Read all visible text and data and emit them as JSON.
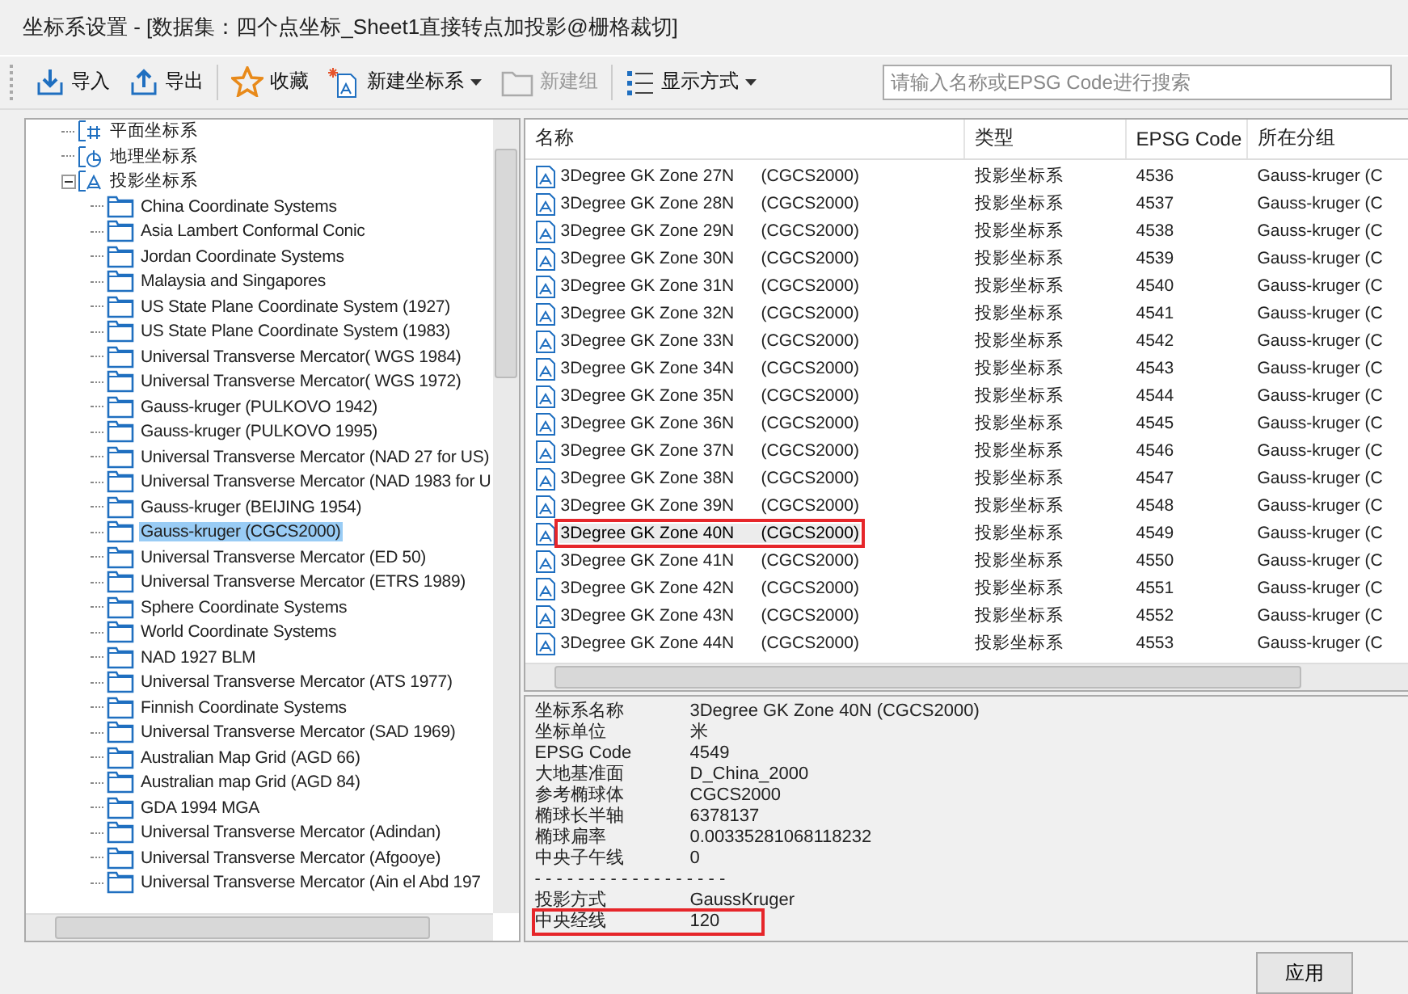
{
  "window": {
    "title": "坐标系设置 - [数据集：四个点坐标_Sheet1直接转点加投影@栅格裁切]"
  },
  "toolbar": {
    "items": [
      {
        "kind": "import",
        "label": "导入",
        "disabled": false,
        "dropdown": false
      },
      {
        "kind": "export",
        "label": "导出",
        "disabled": false,
        "dropdown": false
      },
      {
        "kind": "favorite",
        "label": "收藏",
        "disabled": false,
        "dropdown": false
      },
      {
        "kind": "new",
        "label": "新建坐标系",
        "disabled": false,
        "dropdown": true
      },
      {
        "kind": "group",
        "label": "新建组",
        "disabled": true,
        "dropdown": false
      },
      {
        "kind": "view",
        "label": "显示方式",
        "disabled": false,
        "dropdown": true
      }
    ],
    "search": {
      "placeholder": "请输入名称或EPSG Code进行搜索"
    }
  },
  "tree": [
    {
      "kind": "plane",
      "label": "平面坐标系",
      "selected": false
    },
    {
      "kind": "geo",
      "label": "地理坐标系",
      "selected": false
    },
    {
      "kind": "proj",
      "label": "投影坐标系",
      "selected": false,
      "expanded": true,
      "children": [
        {
          "label": "China Coordinate Systems",
          "selected": false
        },
        {
          "label": "Asia Lambert Conformal Conic",
          "selected": false
        },
        {
          "label": "Jordan Coordinate Systems",
          "selected": false
        },
        {
          "label": "Malaysia and Singapores",
          "selected": false
        },
        {
          "label": "US State Plane Coordinate System (1927)",
          "selected": false
        },
        {
          "label": "US State Plane Coordinate System (1983)",
          "selected": false
        },
        {
          "label": "Universal Transverse Mercator( WGS 1984)",
          "selected": false
        },
        {
          "label": "Universal Transverse Mercator( WGS 1972)",
          "selected": false
        },
        {
          "label": "Gauss-kruger (PULKOVO 1942)",
          "selected": false
        },
        {
          "label": "Gauss-kruger (PULKOVO 1995)",
          "selected": false
        },
        {
          "label": "Universal Transverse Mercator (NAD 27 for US)",
          "selected": false
        },
        {
          "label": "Universal Transverse Mercator (NAD 1983 for U",
          "selected": false
        },
        {
          "label": "Gauss-kruger (BEIJING 1954)",
          "selected": false
        },
        {
          "label": "Gauss-kruger (CGCS2000)",
          "selected": true
        },
        {
          "label": "Universal Transverse Mercator (ED 50)",
          "selected": false
        },
        {
          "label": "Universal Transverse Mercator (ETRS 1989)",
          "selected": false
        },
        {
          "label": "Sphere Coordinate Systems",
          "selected": false
        },
        {
          "label": "World Coordinate Systems",
          "selected": false
        },
        {
          "label": "NAD 1927 BLM",
          "selected": false
        },
        {
          "label": "Universal Transverse Mercator (ATS 1977)",
          "selected": false
        },
        {
          "label": "Finnish Coordinate Systems",
          "selected": false
        },
        {
          "label": "Universal Transverse Mercator (SAD 1969)",
          "selected": false
        },
        {
          "label": "Australian Map Grid (AGD 66)",
          "selected": false
        },
        {
          "label": "Australian map Grid (AGD 84)",
          "selected": false
        },
        {
          "label": "GDA 1994 MGA",
          "selected": false
        },
        {
          "label": "Universal Transverse Mercator (Adindan)",
          "selected": false
        },
        {
          "label": "Universal Transverse Mercator (Afgooye)",
          "selected": false
        },
        {
          "label": "Universal Transverse Mercator (Ain el Abd 197",
          "selected": false
        }
      ]
    }
  ],
  "table": {
    "columns": [
      "名称",
      "类型",
      "EPSG Code",
      "所在分组"
    ],
    "rows": [
      {
        "name": "3Degree GK Zone 27N",
        "datum": "(CGCS2000)",
        "type": "投影坐标系",
        "epsg": "4536",
        "group": "Gauss-kruger (C",
        "selected": false
      },
      {
        "name": "3Degree GK Zone 28N",
        "datum": "(CGCS2000)",
        "type": "投影坐标系",
        "epsg": "4537",
        "group": "Gauss-kruger (C",
        "selected": false
      },
      {
        "name": "3Degree GK Zone 29N",
        "datum": "(CGCS2000)",
        "type": "投影坐标系",
        "epsg": "4538",
        "group": "Gauss-kruger (C",
        "selected": false
      },
      {
        "name": "3Degree GK Zone 30N",
        "datum": "(CGCS2000)",
        "type": "投影坐标系",
        "epsg": "4539",
        "group": "Gauss-kruger (C",
        "selected": false
      },
      {
        "name": "3Degree GK Zone 31N",
        "datum": "(CGCS2000)",
        "type": "投影坐标系",
        "epsg": "4540",
        "group": "Gauss-kruger (C",
        "selected": false
      },
      {
        "name": "3Degree GK Zone 32N",
        "datum": "(CGCS2000)",
        "type": "投影坐标系",
        "epsg": "4541",
        "group": "Gauss-kruger (C",
        "selected": false
      },
      {
        "name": "3Degree GK Zone 33N",
        "datum": "(CGCS2000)",
        "type": "投影坐标系",
        "epsg": "4542",
        "group": "Gauss-kruger (C",
        "selected": false
      },
      {
        "name": "3Degree GK Zone 34N",
        "datum": "(CGCS2000)",
        "type": "投影坐标系",
        "epsg": "4543",
        "group": "Gauss-kruger (C",
        "selected": false
      },
      {
        "name": "3Degree GK Zone 35N",
        "datum": "(CGCS2000)",
        "type": "投影坐标系",
        "epsg": "4544",
        "group": "Gauss-kruger (C",
        "selected": false
      },
      {
        "name": "3Degree GK Zone 36N",
        "datum": "(CGCS2000)",
        "type": "投影坐标系",
        "epsg": "4545",
        "group": "Gauss-kruger (C",
        "selected": false
      },
      {
        "name": "3Degree GK Zone 37N",
        "datum": "(CGCS2000)",
        "type": "投影坐标系",
        "epsg": "4546",
        "group": "Gauss-kruger (C",
        "selected": false
      },
      {
        "name": "3Degree GK Zone 38N",
        "datum": "(CGCS2000)",
        "type": "投影坐标系",
        "epsg": "4547",
        "group": "Gauss-kruger (C",
        "selected": false
      },
      {
        "name": "3Degree GK Zone 39N",
        "datum": "(CGCS2000)",
        "type": "投影坐标系",
        "epsg": "4548",
        "group": "Gauss-kruger (C",
        "selected": false
      },
      {
        "name": "3Degree GK Zone 40N",
        "datum": "(CGCS2000)",
        "type": "投影坐标系",
        "epsg": "4549",
        "group": "Gauss-kruger (C",
        "selected": true
      },
      {
        "name": "3Degree GK Zone 41N",
        "datum": "(CGCS2000)",
        "type": "投影坐标系",
        "epsg": "4550",
        "group": "Gauss-kruger (C",
        "selected": false
      },
      {
        "name": "3Degree GK Zone 42N",
        "datum": "(CGCS2000)",
        "type": "投影坐标系",
        "epsg": "4551",
        "group": "Gauss-kruger (C",
        "selected": false
      },
      {
        "name": "3Degree GK Zone 43N",
        "datum": "(CGCS2000)",
        "type": "投影坐标系",
        "epsg": "4552",
        "group": "Gauss-kruger (C",
        "selected": false
      },
      {
        "name": "3Degree GK Zone 44N",
        "datum": "(CGCS2000)",
        "type": "投影坐标系",
        "epsg": "4553",
        "group": "Gauss-kruger (C",
        "selected": false
      }
    ]
  },
  "details": [
    {
      "kind": "field",
      "label": "坐标系名称",
      "value": "3Degree GK Zone 40N    (CGCS2000)",
      "highlighted": false
    },
    {
      "kind": "field",
      "label": "坐标单位",
      "value": "米",
      "highlighted": false
    },
    {
      "kind": "field",
      "label": "EPSG Code",
      "value": "4549",
      "highlighted": false
    },
    {
      "kind": "field",
      "label": "大地基准面",
      "value": "D_China_2000",
      "highlighted": false
    },
    {
      "kind": "field",
      "label": "参考椭球体",
      "value": "CGCS2000",
      "highlighted": false
    },
    {
      "kind": "field",
      "label": "椭球长半轴",
      "value": "6378137",
      "highlighted": false
    },
    {
      "kind": "field",
      "label": "椭球扁率",
      "value": "0.00335281068118232",
      "highlighted": false
    },
    {
      "kind": "field",
      "label": "中央子午线",
      "value": "0",
      "highlighted": false
    },
    {
      "kind": "separator",
      "label": "- - - - - - - - - - - - - - - - - -"
    },
    {
      "kind": "field",
      "label": "投影方式",
      "value": "GaussKruger",
      "highlighted": false
    },
    {
      "kind": "field",
      "label": "中央经线",
      "value": "120",
      "highlighted": true
    }
  ],
  "buttons": [
    "应用"
  ]
}
